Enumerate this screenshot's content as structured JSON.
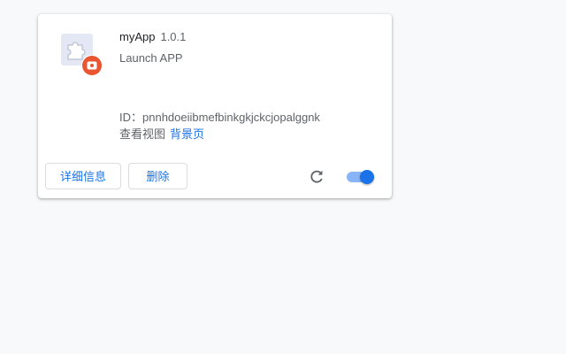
{
  "extension": {
    "name": "myApp",
    "version": "1.0.1",
    "description": "Launch APP",
    "id_label": "ID：",
    "id_value": "pnnhdoeiibmefbinkgkjckcjopalggnk",
    "views_label": "查看视图",
    "views_link": "背景页",
    "enabled": true
  },
  "buttons": {
    "details_label": "详细信息",
    "remove_label": "删除"
  },
  "icons": {
    "extension_icon": "puzzle-piece-icon",
    "badge_icon": "app-badge-icon",
    "reload_icon": "reload-icon"
  },
  "colors": {
    "accent": "#1a73e8",
    "toggle_track": "#8ab4f8",
    "badge": "#e8552f",
    "page_background": "#f8f9fa"
  }
}
